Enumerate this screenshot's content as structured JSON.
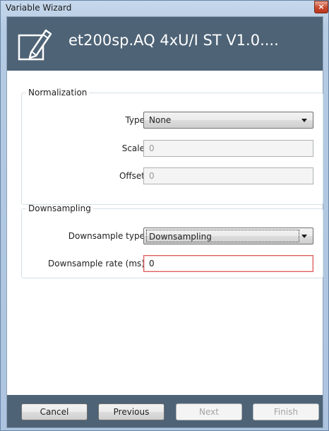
{
  "window": {
    "title": "Variable Wizard",
    "close_glyph": "×"
  },
  "header": {
    "title": "et200sp.AQ 4xU/I ST V1.0....",
    "icon": "edit-icon"
  },
  "normalization": {
    "legend": "Normalization",
    "type_label": "Type",
    "type_value": "None",
    "scale_label": "Scale",
    "scale_value": "0",
    "offset_label": "Offset",
    "offset_value": "0"
  },
  "downsampling": {
    "legend": "Downsampling",
    "type_label": "Downsample type",
    "type_value": "Downsampling",
    "rate_label": "Downsample rate (ms)",
    "rate_value": "0"
  },
  "footer": {
    "cancel_label": "Cancel",
    "previous_label": "Previous",
    "next_label": "Next",
    "finish_label": "Finish"
  },
  "colors": {
    "header_bg": "#4e6376",
    "error_border": "#e05b5b",
    "window_frame": "#b5cbe3"
  }
}
